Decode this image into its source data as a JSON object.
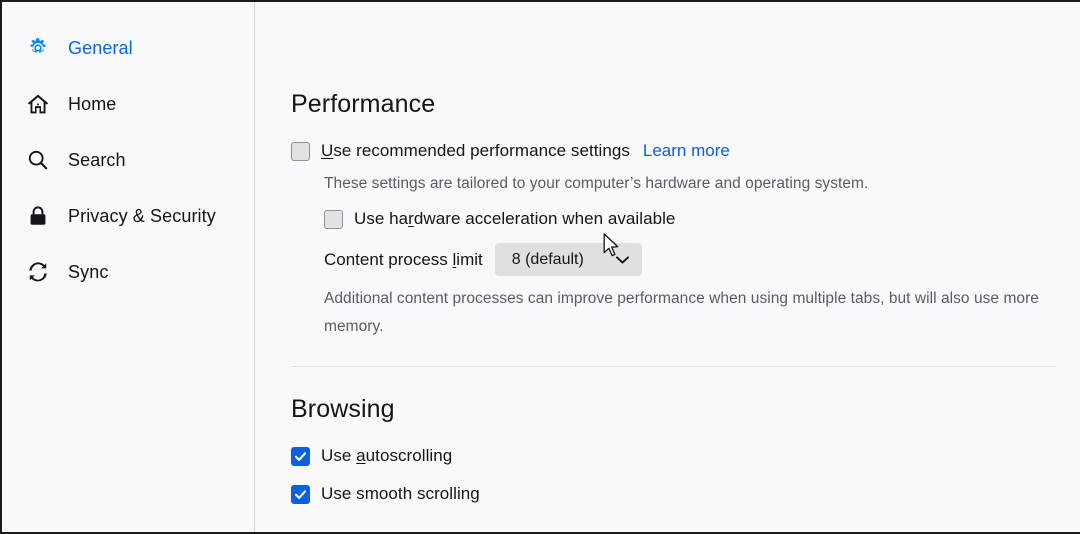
{
  "sidebar": {
    "items": [
      {
        "label": "General",
        "icon": "gear-icon",
        "selected": true
      },
      {
        "label": "Home",
        "icon": "home-icon",
        "selected": false
      },
      {
        "label": "Search",
        "icon": "search-icon",
        "selected": false
      },
      {
        "label": "Privacy & Security",
        "icon": "lock-icon",
        "selected": false
      },
      {
        "label": "Sync",
        "icon": "sync-icon",
        "selected": false
      }
    ]
  },
  "performance": {
    "heading": "Performance",
    "recommended_checkbox": {
      "label_prefix": "",
      "access_key": "U",
      "label_rest": "se recommended performance settings",
      "checked": false
    },
    "learn_more": "Learn more",
    "recommended_description": "These settings are tailored to your computer’s hardware and operating system.",
    "hardware_accel_checkbox": {
      "label_prefix": "Use ha",
      "access_key": "r",
      "label_rest": "dware acceleration when available",
      "checked": false
    },
    "content_process": {
      "label_prefix": "Content process ",
      "access_key": "l",
      "label_rest": "imit",
      "value": "8 (default)"
    },
    "content_process_description": "Additional content processes can improve performance when using multiple tabs, but will also use more memory."
  },
  "browsing": {
    "heading": "Browsing",
    "items": [
      {
        "label_prefix": "Use ",
        "access_key": "a",
        "label_rest": "utoscrolling",
        "checked": true
      },
      {
        "label_prefix": "Use smooth scrolling",
        "access_key": "",
        "label_rest": "",
        "checked": true
      }
    ]
  },
  "colors": {
    "accent_blue": "#0a60df",
    "link_blue": "#0a5ddf",
    "selected_nav": "#0a66e0",
    "text": "#15141a",
    "muted_text": "#5b5b66",
    "background": "#f9f9fb",
    "checkbox_off": "#e2e2e4",
    "select_background": "#e0e0e2"
  }
}
